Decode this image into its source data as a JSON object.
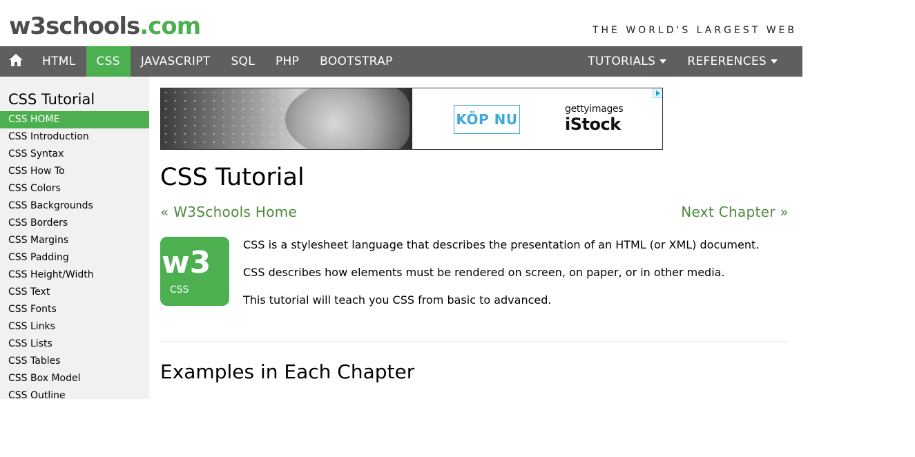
{
  "header": {
    "logo_main": "w3schools",
    "logo_ext": ".com",
    "tagline": "THE WORLD'S LARGEST WEB"
  },
  "topnav": {
    "home_icon": "home-icon",
    "items": [
      {
        "label": "HTML",
        "active": false
      },
      {
        "label": "CSS",
        "active": true
      },
      {
        "label": "JAVASCRIPT",
        "active": false
      },
      {
        "label": "SQL",
        "active": false
      },
      {
        "label": "PHP",
        "active": false
      },
      {
        "label": "BOOTSTRAP",
        "active": false
      }
    ],
    "tutorials": "TUTORIALS",
    "references": "REFERENCES",
    "colors": {
      "bar": "#5f5f5f",
      "active": "#4caf50"
    }
  },
  "sidebar": {
    "title": "CSS Tutorial",
    "items": [
      "CSS HOME",
      "CSS Introduction",
      "CSS Syntax",
      "CSS How To",
      "CSS Colors",
      "CSS Backgrounds",
      "CSS Borders",
      "CSS Margins",
      "CSS Padding",
      "CSS Height/Width",
      "CSS Text",
      "CSS Fonts",
      "CSS Links",
      "CSS Lists",
      "CSS Tables",
      "CSS Box Model",
      "CSS Outline"
    ],
    "active_index": 0
  },
  "ad": {
    "button": "KÖP NU",
    "brand_top": "gettyimages",
    "brand_bottom": "iStock"
  },
  "main": {
    "title": "CSS Tutorial",
    "prev_link": "« W3Schools Home",
    "next_link": "Next Chapter »",
    "logo_label": "CSS",
    "paragraphs": [
      "CSS is a stylesheet language that describes the presentation of an HTML (or XML) document.",
      "CSS describes how elements must be rendered on screen, on paper, or in other media.",
      "This tutorial will teach you CSS from basic to advanced."
    ],
    "section_title": "Examples in Each Chapter"
  }
}
